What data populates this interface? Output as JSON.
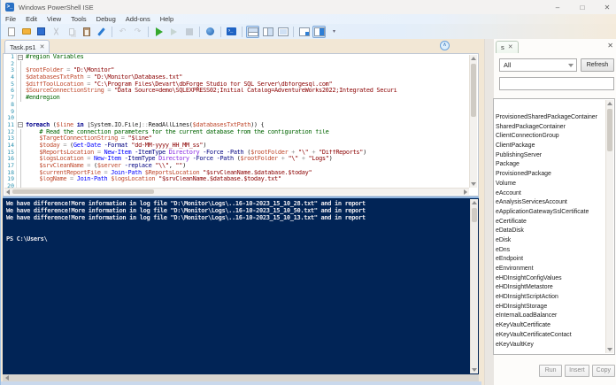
{
  "window": {
    "title": "Windows PowerShell ISE"
  },
  "icons": {
    "minimize": "–",
    "maximize": "□",
    "close": "✕",
    "tab_close": "✕",
    "collapse_chevron": "∧",
    "undo": "↶",
    "redo": "↷",
    "overflow": "▾",
    "app_glyph": ">_",
    "ps_glyph": "›_",
    "fold_minus": "–"
  },
  "menu": {
    "items": [
      "File",
      "Edit",
      "View",
      "Tools",
      "Debug",
      "Add-ons",
      "Help"
    ]
  },
  "toolbar": {
    "buttons": [
      {
        "icon": "new-file"
      },
      {
        "icon": "open-folder"
      },
      {
        "icon": "save"
      },
      {
        "icon": "cut",
        "disabled": true
      },
      {
        "icon": "copy",
        "disabled": true
      },
      {
        "icon": "paste"
      },
      {
        "icon": "clear-console-pane"
      },
      {
        "sep": true
      },
      {
        "icon": "undo",
        "disabled": true
      },
      {
        "icon": "redo",
        "disabled": true
      },
      {
        "sep": true
      },
      {
        "icon": "run-script"
      },
      {
        "icon": "run-selection",
        "disabled": true
      },
      {
        "icon": "stop-operation",
        "disabled": true
      },
      {
        "sep": true
      },
      {
        "icon": "new-remote-powershell-tab"
      },
      {
        "sep": true
      },
      {
        "icon": "start-powershell-exe"
      },
      {
        "sep": true
      },
      {
        "icon": "show-script-pane-top",
        "selected": true
      },
      {
        "icon": "show-script-pane-right"
      },
      {
        "icon": "show-script-pane-maximized"
      },
      {
        "sep": true
      },
      {
        "icon": "show-command-window"
      },
      {
        "icon": "show-command-addon",
        "selected": true
      },
      {
        "icon": "toolbar-overflow"
      }
    ]
  },
  "editor_tab": {
    "label": "Task.ps1"
  },
  "code": {
    "lines": [
      {
        "n": 1,
        "fold": true,
        "tokens": [
          [
            "cmt",
            "#region Variables"
          ]
        ]
      },
      {
        "n": 2,
        "guide": true,
        "tokens": []
      },
      {
        "n": 3,
        "guide": true,
        "tokens": [
          [
            "var",
            "$rootFolder"
          ],
          [
            "op",
            " = "
          ],
          [
            "str",
            "\"D:\\Monitor\""
          ]
        ]
      },
      {
        "n": 4,
        "guide": true,
        "tokens": [
          [
            "var",
            "$databasesTxtPath"
          ],
          [
            "op",
            " = "
          ],
          [
            "str",
            "\"D:\\Monitor\\Databases.txt\""
          ]
        ]
      },
      {
        "n": 5,
        "guide": true,
        "tokens": [
          [
            "var",
            "$diffToolLocation"
          ],
          [
            "op",
            " = "
          ],
          [
            "str",
            "\"C:\\Program Files\\Devart\\dbForge Studio for SQL Server\\dbforgesql.com\""
          ]
        ]
      },
      {
        "n": 6,
        "guide": true,
        "tokens": [
          [
            "var",
            "$SourceConnectionString"
          ],
          [
            "op",
            " = "
          ],
          [
            "str",
            "\"Data Source=demo\\SQLEXPRESS02;Initial Catalog=AdventureWorks2022;Integrated Securi"
          ]
        ]
      },
      {
        "n": 7,
        "guide": true,
        "tokens": [
          [
            "cmt",
            "#endregion"
          ]
        ]
      },
      {
        "n": 8,
        "tokens": []
      },
      {
        "n": 9,
        "tokens": []
      },
      {
        "n": 10,
        "tokens": []
      },
      {
        "n": 11,
        "fold": true,
        "tokens": [
          [
            "kw",
            "foreach"
          ],
          [
            "pln",
            " ("
          ],
          [
            "var",
            "$line"
          ],
          [
            "pln",
            " "
          ],
          [
            "kw",
            "in"
          ],
          [
            "pln",
            " "
          ],
          [
            "typ",
            "[System.IO.File]"
          ],
          [
            "op",
            "::"
          ],
          [
            "pln",
            "ReadAllLines("
          ],
          [
            "var",
            "$databasesTxtPath"
          ],
          [
            "pln",
            ")) {"
          ]
        ]
      },
      {
        "n": 12,
        "guide": true,
        "tokens": [
          [
            "cmt",
            "    # Read the connection parameters for the current database from the configuration file"
          ]
        ]
      },
      {
        "n": 13,
        "guide": true,
        "tokens": [
          [
            "pln",
            "    "
          ],
          [
            "var",
            "$TargetConnectionString"
          ],
          [
            "op",
            " = "
          ],
          [
            "str",
            "\"$line\""
          ]
        ]
      },
      {
        "n": 14,
        "guide": true,
        "tokens": [
          [
            "pln",
            "    "
          ],
          [
            "var",
            "$today"
          ],
          [
            "op",
            " = "
          ],
          [
            "pln",
            "("
          ],
          [
            "cmd",
            "Get-Date"
          ],
          [
            "pln",
            " "
          ],
          [
            "param",
            "-Format"
          ],
          [
            "pln",
            " "
          ],
          [
            "str",
            "\"dd-MM-yyyy_HH_MM_ss\""
          ],
          [
            "pln",
            ")"
          ]
        ]
      },
      {
        "n": 15,
        "guide": true,
        "tokens": [
          [
            "pln",
            "    "
          ],
          [
            "var",
            "$ReportsLocation"
          ],
          [
            "op",
            " = "
          ],
          [
            "cmd",
            "New-Item"
          ],
          [
            "pln",
            " "
          ],
          [
            "param",
            "-ItemType"
          ],
          [
            "pln",
            " "
          ],
          [
            "arg",
            "Directory"
          ],
          [
            "pln",
            " "
          ],
          [
            "param",
            "-Force"
          ],
          [
            "pln",
            " "
          ],
          [
            "param",
            "-Path"
          ],
          [
            "pln",
            " ("
          ],
          [
            "var",
            "$rootFolder"
          ],
          [
            "op",
            " + "
          ],
          [
            "str",
            "\"\\\""
          ],
          [
            "op",
            " + "
          ],
          [
            "str",
            "\"DiffReports\""
          ],
          [
            "pln",
            ")"
          ]
        ]
      },
      {
        "n": 16,
        "guide": true,
        "tokens": [
          [
            "pln",
            "    "
          ],
          [
            "var",
            "$logsLocation"
          ],
          [
            "op",
            " = "
          ],
          [
            "cmd",
            "New-Item"
          ],
          [
            "pln",
            " "
          ],
          [
            "param",
            "-ItemType"
          ],
          [
            "pln",
            " "
          ],
          [
            "arg",
            "Directory"
          ],
          [
            "pln",
            " "
          ],
          [
            "param",
            "-Force"
          ],
          [
            "pln",
            " "
          ],
          [
            "param",
            "-Path"
          ],
          [
            "pln",
            " ("
          ],
          [
            "var",
            "$rootFolder"
          ],
          [
            "op",
            " + "
          ],
          [
            "str",
            "\"\\\""
          ],
          [
            "op",
            " + "
          ],
          [
            "str",
            "\"Logs\""
          ],
          [
            "pln",
            ")"
          ]
        ]
      },
      {
        "n": 17,
        "guide": true,
        "tokens": [
          [
            "pln",
            "    "
          ],
          [
            "var",
            "$srvCleanName"
          ],
          [
            "op",
            " = "
          ],
          [
            "pln",
            "("
          ],
          [
            "var",
            "$server"
          ],
          [
            "pln",
            " "
          ],
          [
            "param",
            "-replace"
          ],
          [
            "pln",
            " "
          ],
          [
            "str",
            "\"\\\\\""
          ],
          [
            "pln",
            ", "
          ],
          [
            "str",
            "\"\""
          ],
          [
            "pln",
            ")"
          ]
        ]
      },
      {
        "n": 18,
        "guide": true,
        "tokens": [
          [
            "pln",
            "    "
          ],
          [
            "var",
            "$currentReportFile"
          ],
          [
            "op",
            " = "
          ],
          [
            "cmd",
            "Join-Path"
          ],
          [
            "pln",
            " "
          ],
          [
            "var",
            "$ReportsLocation"
          ],
          [
            "pln",
            " "
          ],
          [
            "str",
            "\"$srvCleanName.$database.$today\""
          ]
        ]
      },
      {
        "n": 19,
        "guide": true,
        "tokens": [
          [
            "pln",
            "    "
          ],
          [
            "var",
            "$logName"
          ],
          [
            "op",
            " = "
          ],
          [
            "cmd",
            "Join-Path"
          ],
          [
            "pln",
            " "
          ],
          [
            "var",
            "$logsLocation"
          ],
          [
            "pln",
            " "
          ],
          [
            "str",
            "\"$srvCleanName.$database.$today.txt\""
          ]
        ]
      },
      {
        "n": 20,
        "guide": true,
        "tokens": []
      }
    ]
  },
  "console": {
    "lines": [
      "We have difference!More information in log file \"D:\\Monitor\\Logs\\..16-10-2023_15_10_28.txt\" and in report",
      "We have difference!More information in log file \"D:\\Monitor\\Logs\\..16-10-2023_15_10_50.txt\" and in report",
      "We have difference!More information in log file \"D:\\Monitor\\Logs\\..16-10-2023_15_10_13.txt\" and in report",
      "",
      ""
    ],
    "prompt": "PS C:\\Users\\"
  },
  "commands_pane": {
    "tab_label": "s",
    "filter_value": "All",
    "refresh_label": "Refresh",
    "search_value": "",
    "items": [
      "ProvisionedSharedPackageContainer",
      "SharedPackageContainer",
      "ClientConnectionGroup",
      "ClientPackage",
      "PublishingServer",
      "Package",
      "ProvisionedPackage",
      "Volume",
      "eAccount",
      "eAnalysisServicesAccount",
      "eApplicationGatewaySslCertificate",
      "eCertificate",
      "eDataDisk",
      "eDisk",
      "eDns",
      "eEndpoint",
      "eEnvironment",
      "eHDInsightConfigValues",
      "eHDInsightMetastore",
      "eHDInsightScriptAction",
      "eHDInsightStorage",
      "eInternalLoadBalancer",
      "eKeyVaultCertificate",
      "eKeyVaultCertificateContact",
      "eKeyVaultKey"
    ],
    "buttons": [
      "Run",
      "Insert",
      "Copy"
    ]
  },
  "colors": {
    "console_bg": "#012456",
    "console_text": "#EDEBF0",
    "comment": "#006400",
    "variable": "#c04a2e",
    "string": "#8B0000",
    "keyword": "#00008B",
    "cmdlet": "#0000FF",
    "parameter": "#000080",
    "argument": "#8A2BE2",
    "line_number": "#2B91AF",
    "toolbar_bg": "#e3eefa",
    "window_bg": "#f2e7d5",
    "run_green": "#35a82e"
  }
}
